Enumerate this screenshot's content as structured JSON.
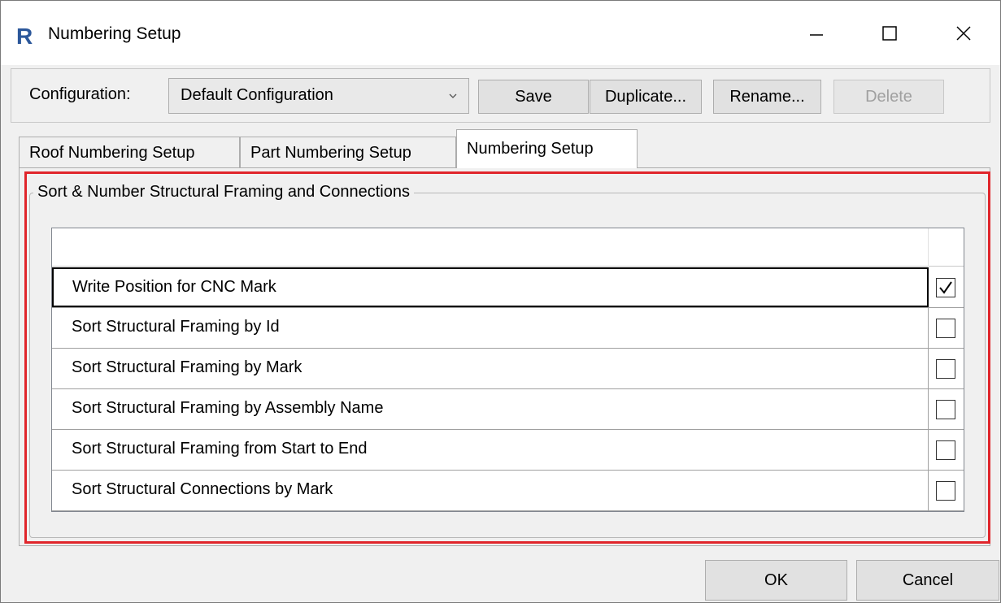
{
  "window": {
    "title": "Numbering Setup",
    "app_icon_letter": "R",
    "brand_color": "#2b579a",
    "highlight_color": "#e0252b"
  },
  "toolbar": {
    "config_label": "Configuration:",
    "config_value": "Default Configuration",
    "save_label": "Save",
    "duplicate_label": "Duplicate...",
    "rename_label": "Rename...",
    "delete_label": "Delete"
  },
  "tabs": [
    {
      "label": "Roof Numbering Setup",
      "active": false
    },
    {
      "label": "Part Numbering Setup",
      "active": false
    },
    {
      "label": "Numbering Setup",
      "active": true
    }
  ],
  "group": {
    "title": "Sort & Number Structural Framing and Connections"
  },
  "grid": {
    "rows": [
      {
        "label": "Write Position for CNC Mark",
        "checked": true,
        "selected": true
      },
      {
        "label": "Sort Structural Framing by Id",
        "checked": false,
        "selected": false
      },
      {
        "label": "Sort Structural Framing by Mark",
        "checked": false,
        "selected": false
      },
      {
        "label": "Sort Structural Framing by Assembly Name",
        "checked": false,
        "selected": false
      },
      {
        "label": "Sort Structural Framing from Start to End",
        "checked": false,
        "selected": false
      },
      {
        "label": "Sort Structural Connections by Mark",
        "checked": false,
        "selected": false
      }
    ]
  },
  "footer": {
    "ok_label": "OK",
    "cancel_label": "Cancel"
  }
}
